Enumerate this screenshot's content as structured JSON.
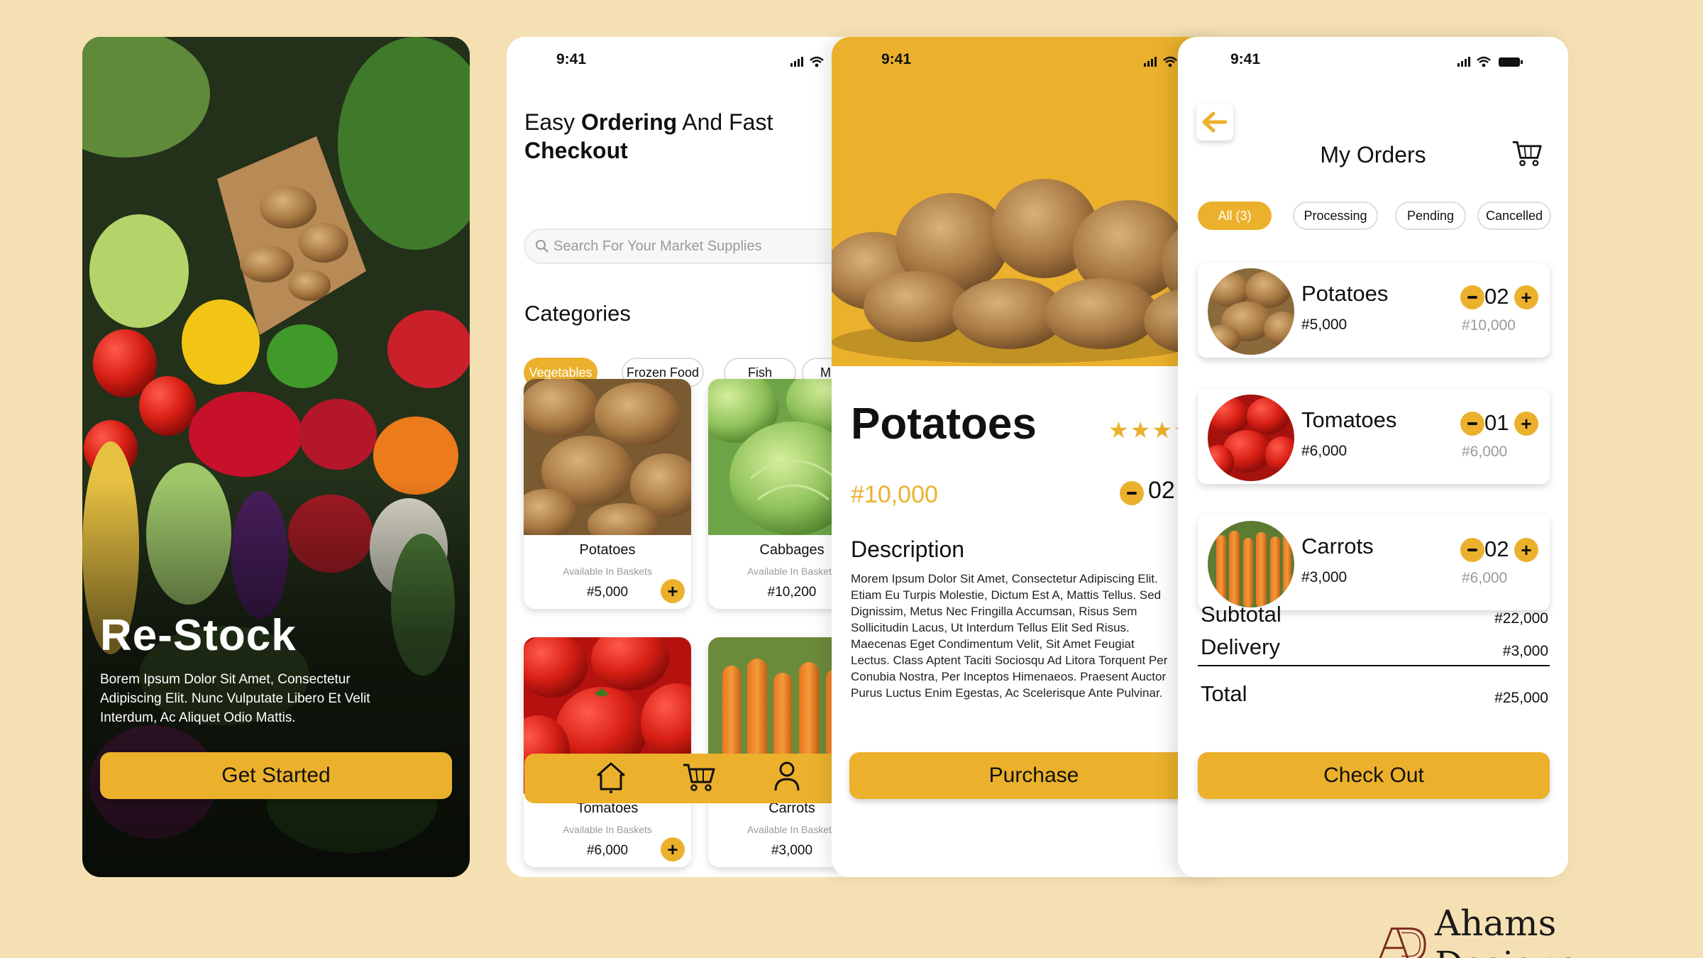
{
  "brand": {
    "name": "Ahams Designs",
    "mark_text": "AD"
  },
  "colors": {
    "accent": "#ebb12c",
    "background": "#f5e0b3",
    "muted": "#9a9a9a"
  },
  "status_bar": {
    "time": "9:41"
  },
  "screen_onboarding": {
    "title": "Re-Stock",
    "description": "Borem Ipsum Dolor Sit Amet, Consectetur Adipiscing Elit. Nunc Vulputate Libero Et Velit Interdum, Ac Aliquet Odio Mattis.",
    "cta_label": "Get Started"
  },
  "screen_browse": {
    "heading_prefix": "Easy ",
    "heading_bold_1": "Ordering",
    "heading_mid": " And Fast",
    "heading_bold_2": "Checkout",
    "search_placeholder": "Search For Your Market Supplies",
    "categories_title": "Categories",
    "categories": [
      "Vegetables",
      "Frozen Food",
      "Fish",
      "M"
    ],
    "products": [
      {
        "name": "Potatoes",
        "availability": "Available In Baskets",
        "price": "#5,000"
      },
      {
        "name": "Cabbages",
        "availability": "Available In Baskets",
        "price": "#10,200"
      },
      {
        "name": "Tomatoes",
        "availability": "Available In Baskets",
        "price": "#6,000"
      },
      {
        "name": "Carrots",
        "availability": "Available In Baskets",
        "price": "#3,000"
      }
    ]
  },
  "screen_detail": {
    "product_name": "Potatoes",
    "stars": "★★★★",
    "price": "#10,000",
    "quantity": "02",
    "description_title": "Description",
    "description_lines": [
      "Morem Ipsum Dolor Sit Amet, Consectetur Adipiscing Elit.",
      "Etiam Eu Turpis Molestie, Dictum Est A, Mattis Tellus. Sed",
      "Dignissim, Metus Nec Fringilla Accumsan, Risus Sem",
      "Sollicitudin Lacus, Ut Interdum Tellus Elit Sed Risus.",
      "Maecenas Eget Condimentum Velit, Sit Amet Feugiat",
      "Lectus. Class Aptent Taciti Sociosqu Ad Litora Torquent Per",
      "Conubia Nostra, Per Inceptos Himenaeos. Praesent Auctor",
      "Purus Luctus Enim Egestas, Ac Scelerisque Ante Pulvinar."
    ],
    "cta_label": "Purchase"
  },
  "screen_orders": {
    "title": "My Orders",
    "filters": [
      "All (3)",
      "Processing",
      "Pending",
      "Cancelled"
    ],
    "items": [
      {
        "name": "Potatoes",
        "unit_price": "#5,000",
        "quantity": "02",
        "total": "#10,000"
      },
      {
        "name": "Tomatoes",
        "unit_price": "#6,000",
        "quantity": "01",
        "total": "#6,000"
      },
      {
        "name": "Carrots",
        "unit_price": "#3,000",
        "quantity": "02",
        "total": "#6,000"
      }
    ],
    "subtotal_label": "Subtotal",
    "subtotal_value": "#22,000",
    "delivery_label": "Delivery",
    "delivery_value": "#3,000",
    "total_label": "Total",
    "total_value": "#25,000",
    "cta_label": "Check Out"
  }
}
